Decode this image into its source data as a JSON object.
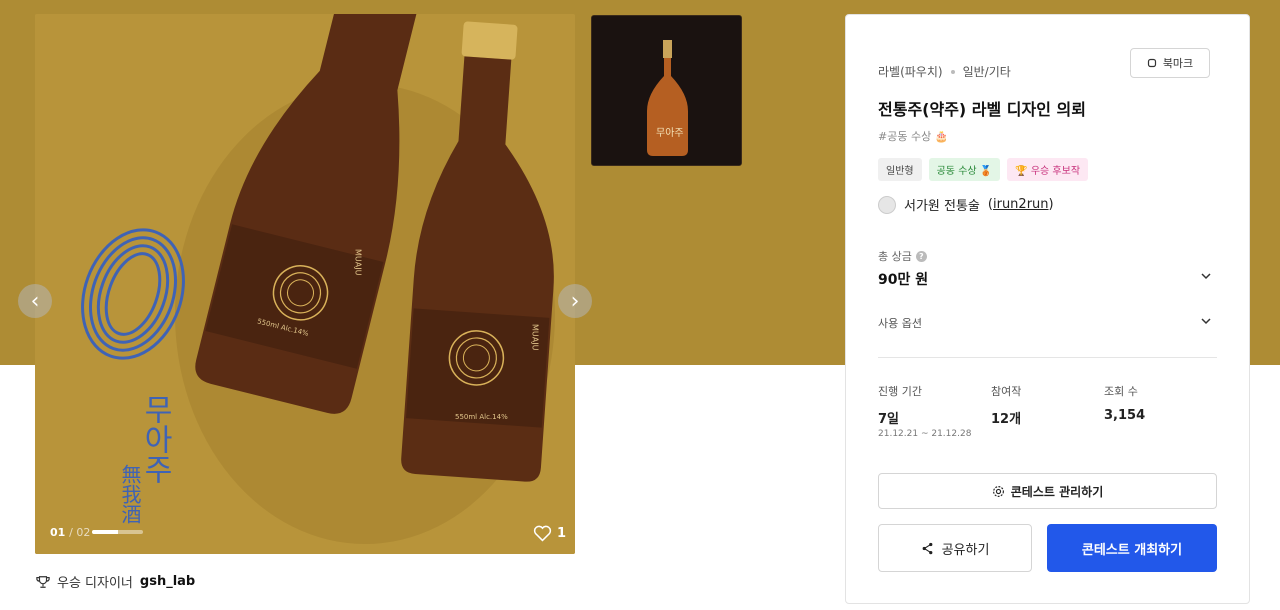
{
  "gallery": {
    "current": "01",
    "total": "02",
    "progress_fraction": 0.5,
    "like_count": "1",
    "winner_prefix": "우승 디자이너",
    "winner_name": "gsh_lab"
  },
  "artwork": {
    "logo_hangul": "무아주",
    "logo_hanja": "無我酒",
    "label_roman": "MUAJU",
    "label_spec": "550ml Alc.14%"
  },
  "contest": {
    "category": "라벨(파우치)",
    "subcategory": "일반/기타",
    "bookmark_label": "북마크",
    "title": "전통주(약주) 라벨 디자인 의뢰",
    "tagline": "#공동 수상 🎂",
    "badges": [
      {
        "label": "일반형",
        "style": "gray"
      },
      {
        "label": "공동 수상 🥉",
        "style": "green"
      },
      {
        "label": "🏆 우승 후보작",
        "style": "pink"
      }
    ],
    "host_name": "서가원 전통술",
    "host_id": "irun2run",
    "prize_label": "총 상금",
    "prize_value": "90만 원",
    "usage_label": "사용 옵션",
    "stats": [
      {
        "label": "진행 기간",
        "value": "7일"
      },
      {
        "label": "참여작",
        "value": "12개"
      },
      {
        "label": "조회 수",
        "value": "3,154"
      }
    ],
    "date_range": "21.12.21 ~ 21.12.28",
    "manage_label": "콘테스트 관리하기",
    "share_label": "공유하기",
    "host_contest_label": "콘테스트 개최하기"
  },
  "colors": {
    "banner": "#ae8c34",
    "primary_button": "#2258ea"
  }
}
